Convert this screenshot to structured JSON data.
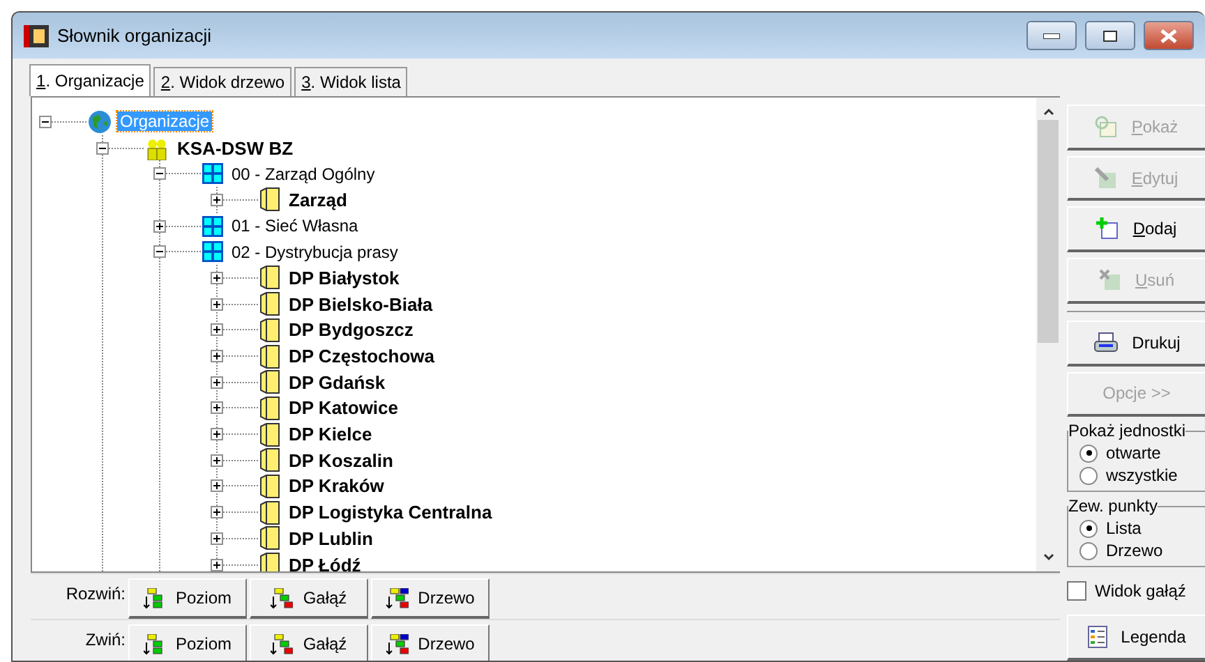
{
  "window": {
    "title": "Słownik organizacji"
  },
  "tabs": [
    {
      "label": "1. Organizacje",
      "selected": true
    },
    {
      "label": "2. Widok drzewo",
      "selected": false
    },
    {
      "label": "3. Widok lista",
      "selected": false
    }
  ],
  "tree": [
    {
      "label": "Organizacje",
      "kind": "globe",
      "expanded": true,
      "selected": true,
      "children": [
        {
          "label": "KSA-DSW BZ",
          "kind": "org",
          "expanded": true,
          "selected": false,
          "children": [
            {
              "label": "00 - Zarząd Ogólny",
              "kind": "unit",
              "expanded": true,
              "selected": false,
              "children": [
                {
                  "label": "Zarząd",
                  "kind": "folder",
                  "expanded": false,
                  "selected": false
                }
              ]
            },
            {
              "label": "01 - Sieć Własna",
              "kind": "unit",
              "expanded": false,
              "selected": false
            },
            {
              "label": "02 - Dystrybucja prasy",
              "kind": "unit",
              "expanded": true,
              "selected": false,
              "children": [
                {
                  "label": "DP Białystok",
                  "kind": "folder",
                  "expanded": false,
                  "selected": false
                },
                {
                  "label": "DP Bielsko-Biała",
                  "kind": "folder",
                  "expanded": false,
                  "selected": false
                },
                {
                  "label": "DP Bydgoszcz",
                  "kind": "folder",
                  "expanded": false,
                  "selected": false
                },
                {
                  "label": "DP Częstochowa",
                  "kind": "folder",
                  "expanded": false,
                  "selected": false
                },
                {
                  "label": "DP Gdańsk",
                  "kind": "folder",
                  "expanded": false,
                  "selected": false
                },
                {
                  "label": "DP Katowice",
                  "kind": "folder",
                  "expanded": false,
                  "selected": false
                },
                {
                  "label": "DP Kielce",
                  "kind": "folder",
                  "expanded": false,
                  "selected": false
                },
                {
                  "label": "DP Koszalin",
                  "kind": "folder",
                  "expanded": false,
                  "selected": false
                },
                {
                  "label": "DP Kraków",
                  "kind": "folder",
                  "expanded": false,
                  "selected": false
                },
                {
                  "label": "DP Logistyka Centralna",
                  "kind": "folder",
                  "expanded": false,
                  "selected": false
                },
                {
                  "label": "DP Lublin",
                  "kind": "folder",
                  "expanded": false,
                  "selected": false
                },
                {
                  "label": "DP Łódź",
                  "kind": "folder",
                  "expanded": false,
                  "selected": false
                }
              ]
            }
          ]
        }
      ]
    }
  ],
  "side_buttons": [
    {
      "label": "Pokaż",
      "kind": "view",
      "disabled": true,
      "mnemonic": true
    },
    {
      "label": "Edytuj",
      "kind": "edit",
      "disabled": true,
      "mnemonic": true
    },
    {
      "label": "Dodaj",
      "kind": "add",
      "disabled": false,
      "mnemonic": true
    },
    {
      "label": "Usuń",
      "kind": "delete",
      "disabled": true,
      "mnemonic": true
    },
    {
      "label": "Drukuj",
      "kind": "print",
      "disabled": false,
      "mnemonic": false
    },
    {
      "label": "Opcje >>",
      "kind": "options",
      "disabled": true,
      "mnemonic": false
    }
  ],
  "radio_groups": [
    {
      "title": "Pokaż jednostki",
      "options": [
        {
          "label": "otwarte",
          "selected": true
        },
        {
          "label": "wszystkie",
          "selected": false
        }
      ]
    },
    {
      "title": "Zew. punkty",
      "options": [
        {
          "label": "Lista",
          "selected": true
        },
        {
          "label": "Drzewo",
          "selected": false
        }
      ]
    }
  ],
  "branch_view": {
    "label": "Widok gałąź",
    "checked": false
  },
  "legend_button": {
    "label": "Legenda"
  },
  "expand_bar": {
    "label": "Rozwiń:",
    "buttons": [
      {
        "label": "Poziom",
        "kind": "level"
      },
      {
        "label": "Gałąź",
        "kind": "branch"
      },
      {
        "label": "Drzewo",
        "kind": "tree"
      }
    ]
  },
  "collapse_bar": {
    "label": "Zwiń:",
    "buttons": [
      {
        "label": "Poziom",
        "kind": "level"
      },
      {
        "label": "Gałąź",
        "kind": "branch"
      },
      {
        "label": "Drzewo",
        "kind": "tree"
      }
    ]
  }
}
